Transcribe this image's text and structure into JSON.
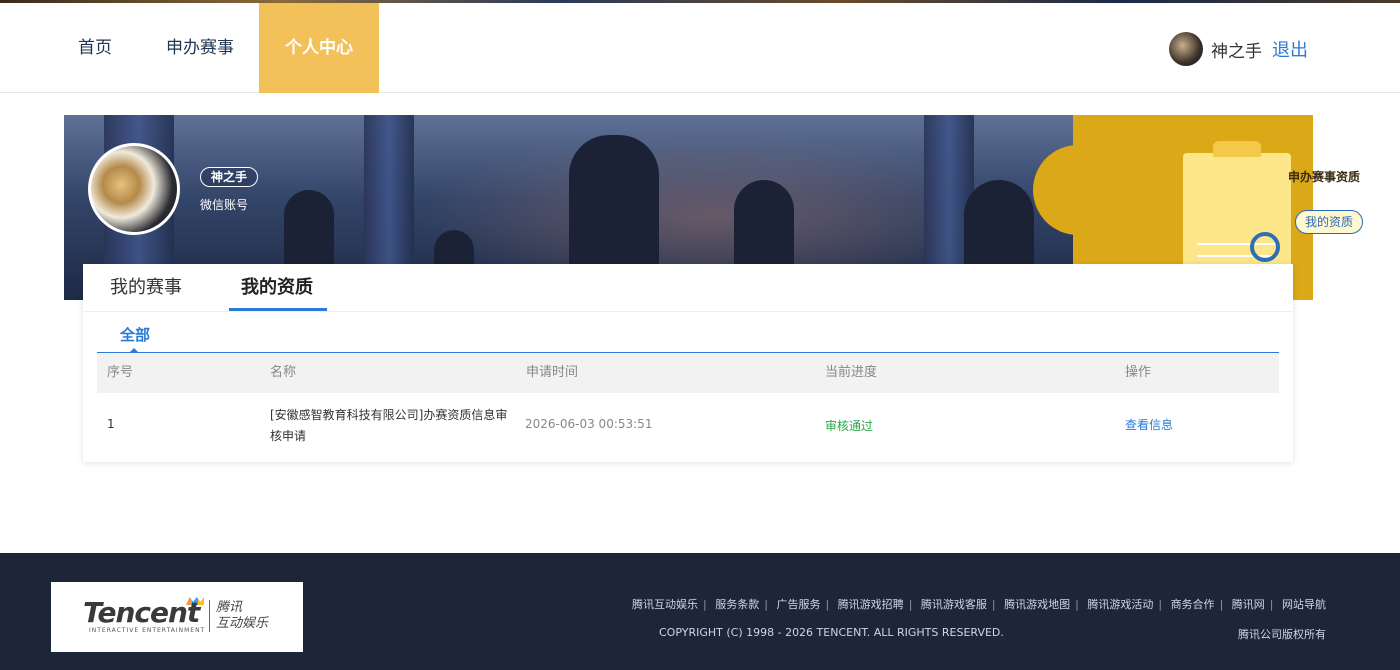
{
  "nav": {
    "items": [
      {
        "label": "首页"
      },
      {
        "label": "申办赛事"
      },
      {
        "label": "个人中心"
      }
    ],
    "active_index": 2,
    "username": "神之手",
    "logout_label": "退出"
  },
  "profile": {
    "name": "神之手",
    "account_type": "微信账号"
  },
  "banner_card": {
    "title": "申办赛事资质",
    "button_label": "我的资质"
  },
  "tabs": [
    {
      "label": "我的赛事"
    },
    {
      "label": "我的资质"
    }
  ],
  "active_tab": 1,
  "subtab": "全部",
  "table": {
    "headers": [
      "序号",
      "名称",
      "申请时间",
      "当前进度",
      "操作"
    ],
    "rows": [
      {
        "index": "1",
        "name": "[安徽感智教育科技有限公司]办赛资质信息审核申请",
        "time": "2026-06-03 00:53:51",
        "status": "审核通过",
        "action": "查看信息"
      }
    ]
  },
  "footer": {
    "logo_text": "Tencent",
    "logo_sub": "INTERACTIVE ENTERTAINMENT",
    "logo_cn_line1": "腾讯",
    "logo_cn_line2": "互动娱乐",
    "links": [
      "腾讯互动娱乐",
      "服务条款",
      "广告服务",
      "腾讯游戏招聘",
      "腾讯游戏客服",
      "腾讯游戏地图",
      "腾讯游戏活动",
      "商务合作",
      "腾讯网",
      "网站导航"
    ],
    "copyright": "COPYRIGHT (C) 1998 - 2026 TENCENT. ALL RIGHTS RESERVED.",
    "rights": "腾讯公司版权所有"
  },
  "colors": {
    "accent_blue": "#2a7ad8",
    "nav_active": "#f2c15a",
    "status_green": "#2aa84a",
    "footer_bg": "#1c2638"
  }
}
